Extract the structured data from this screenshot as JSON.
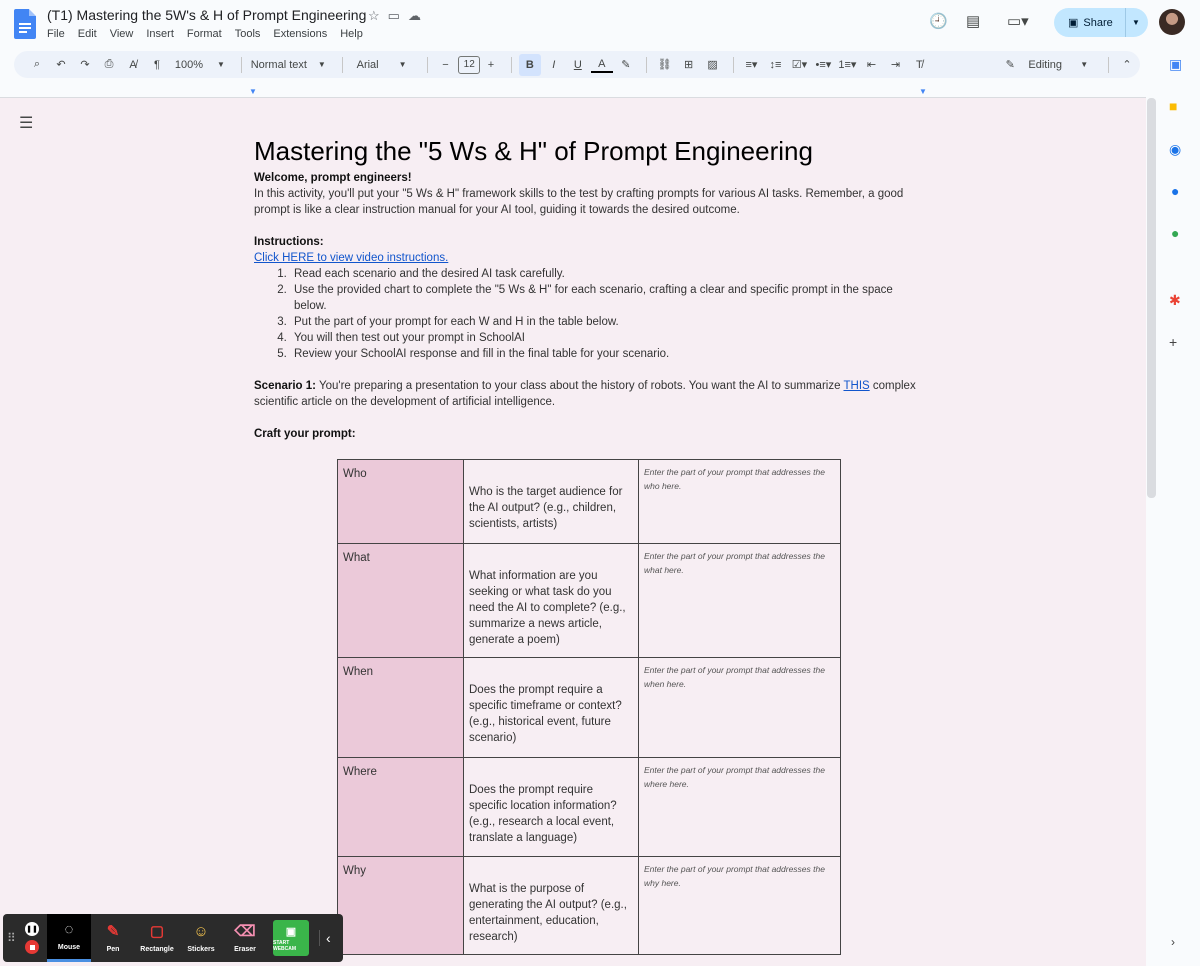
{
  "window": {
    "title": "(T1) Mastering the 5W's & H of Prompt Engineering",
    "menu": [
      "File",
      "Edit",
      "View",
      "Insert",
      "Format",
      "Tools",
      "Extensions",
      "Help"
    ],
    "share_label": "Share"
  },
  "toolbar": {
    "zoom": "100%",
    "style": "Normal text",
    "font": "Arial",
    "font_size": "12",
    "mode": "Editing"
  },
  "doc": {
    "title": "Mastering the \"5 Ws & H\" of Prompt Engineering",
    "welcome": "Welcome, prompt engineers!",
    "intro": "In this activity, you'll put your \"5 Ws & H\" framework skills to the test by crafting prompts for various AI tasks. Remember, a good prompt is like a clear instruction manual for your AI tool, guiding it towards the desired outcome.",
    "instructions_heading": "Instructions:",
    "video_link": "Click HERE to view video instructions.",
    "steps": [
      "Read each scenario and the desired AI task carefully.",
      "Use the provided chart to complete the \"5 Ws & H\" for each scenario, crafting a clear and specific prompt in the space below.",
      "Put the part of your prompt for each W and H in the table below.",
      "You will then test out your prompt in SchoolAI",
      "Review your SchoolAI response and fill in the final table for your scenario."
    ],
    "scenario_label": "Scenario 1:",
    "scenario_text": " You're preparing a presentation to your class about the history of robots. You want the AI to summarize ",
    "scenario_link": "THIS",
    "scenario_text2": " complex scientific article on the development of artificial intelligence.",
    "craft": "Craft your prompt:"
  },
  "table": [
    {
      "key": "Who",
      "question": "Who is the target audience for the AI output? (e.g., children, scientists, artists)",
      "entry": "Enter the part of your prompt that addresses the who here."
    },
    {
      "key": "What",
      "question": "What information are you seeking or what task do you need the AI to complete? (e.g., summarize a news article, generate a poem)",
      "entry": "Enter the part of your prompt that addresses the what here."
    },
    {
      "key": "When",
      "question": "Does the prompt require a specific timeframe or context? (e.g., historical event, future scenario)",
      "entry": "Enter the part of your prompt that addresses the when here."
    },
    {
      "key": "Where",
      "question": "Does the prompt require specific location information? (e.g., research a local event, translate a language)",
      "entry": "Enter the part of your prompt that addresses the where here."
    },
    {
      "key": "Why",
      "question": "What is the purpose of generating the AI output? (e.g., entertainment, education, research)",
      "entry": "Enter the part of your prompt that addresses the why here."
    }
  ],
  "recorder": {
    "tools": [
      "Mouse",
      "Pen",
      "Rectangle",
      "Stickers",
      "Eraser"
    ],
    "webcam": "START WEBCAM"
  }
}
